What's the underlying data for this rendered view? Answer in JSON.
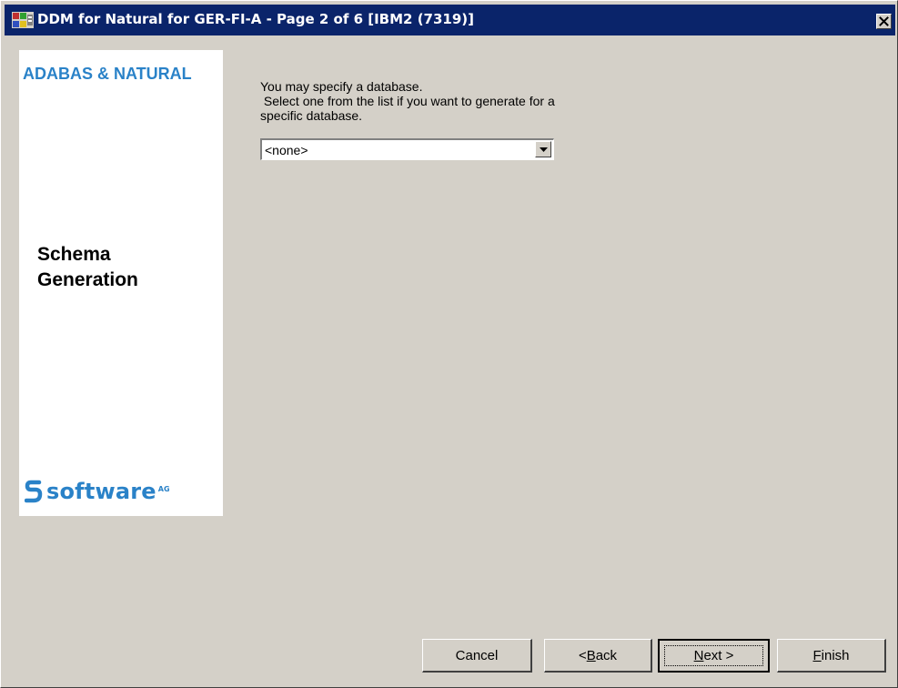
{
  "window": {
    "title": "DDM for Natural for GER-FI-A - Page 2 of 6 [IBM2 (7319)]",
    "close_glyph": "✕"
  },
  "side_panel": {
    "brand_title": "ADABAS & NATURAL",
    "section_title_line1": "Schema",
    "section_title_line2": "Generation",
    "logo_word": "software",
    "logo_suffix": "AG"
  },
  "main": {
    "prompt_line1": "You may specify a database.",
    "prompt_line2": " Select one from the list if you want to generate for a",
    "prompt_line3": "specific database.",
    "database_select": {
      "selected": "<none>"
    }
  },
  "buttons": {
    "cancel": {
      "prefix": "Cancel",
      "mnemonic": "",
      "suffix": ""
    },
    "back": {
      "prefix": "<",
      "mnemonic": "B",
      "suffix": "ack"
    },
    "next": {
      "prefix": "",
      "mnemonic": "N",
      "suffix": "ext >"
    },
    "finish": {
      "prefix": "",
      "mnemonic": "F",
      "suffix": "inish"
    }
  },
  "colors": {
    "titlebar": "#0a246a",
    "brand_blue": "#2a82c8",
    "dialog_face": "#d4d0c8"
  },
  "icons": {
    "app": "ddm-app-icon",
    "close": "close-icon",
    "dropdown": "chevron-down-icon",
    "logo": "software-ag-logo"
  }
}
